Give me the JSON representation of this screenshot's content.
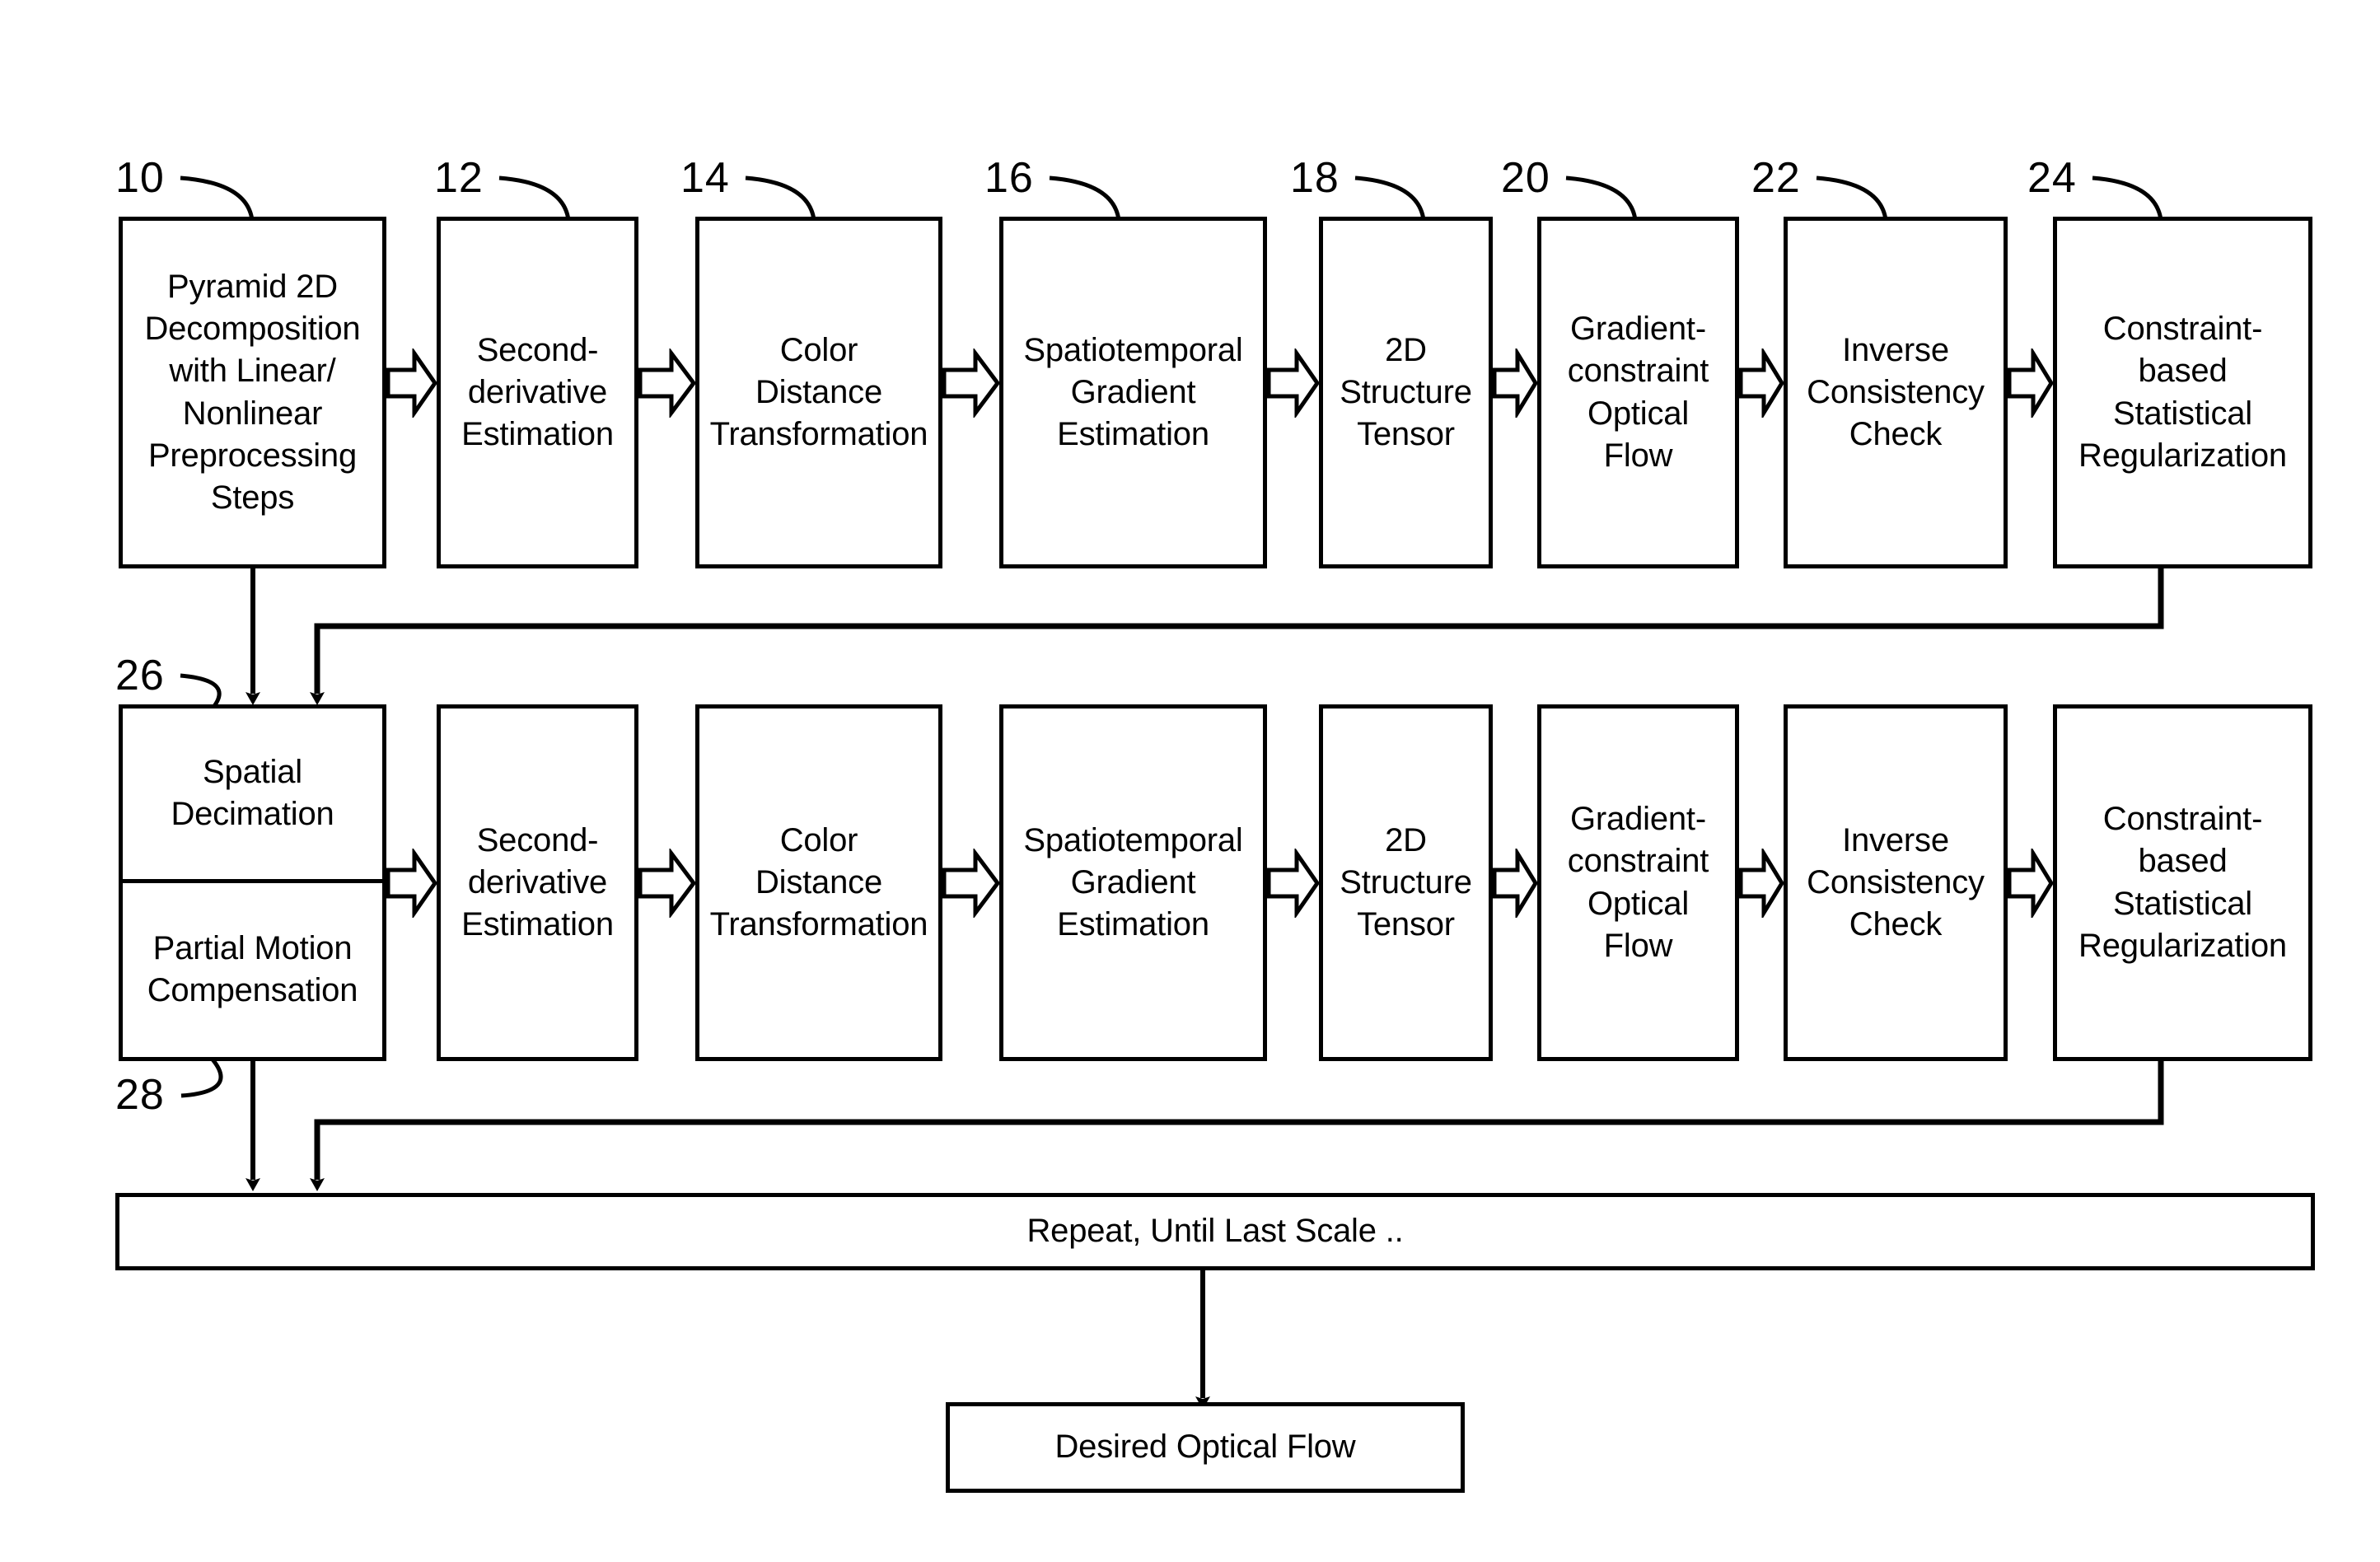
{
  "figure": {
    "type": "patent-flow-diagram",
    "background": "#ffffff",
    "stroke": "#000000"
  },
  "row1": {
    "nodes": [
      {
        "ref": "10",
        "label": "Pyramid 2D\nDecomposition\nwith Linear/\nNonlinear\nPreprocessing\nSteps"
      },
      {
        "ref": "12",
        "label": "Second-\nderivative\nEstimation"
      },
      {
        "ref": "14",
        "label": "Color\nDistance\nTransformation"
      },
      {
        "ref": "16",
        "label": "Spatiotemporal\nGradient\nEstimation"
      },
      {
        "ref": "18",
        "label": "2D\nStructure\nTensor"
      },
      {
        "ref": "20",
        "label": "Gradient-\nconstraint\nOptical\nFlow"
      },
      {
        "ref": "22",
        "label": "Inverse\nConsistency\nCheck"
      },
      {
        "ref": "24",
        "label": "Constraint-\nbased\nStatistical\nRegularization"
      }
    ]
  },
  "row2": {
    "nodes": [
      {
        "ref": "26",
        "ref2": "28",
        "label_top": "Spatial\nDecimation",
        "label_bottom": "Partial Motion\nCompensation"
      },
      {
        "label": "Second-\nderivative\nEstimation"
      },
      {
        "label": "Color\nDistance\nTransformation"
      },
      {
        "label": "Spatiotemporal\nGradient\nEstimation"
      },
      {
        "label": "2D\nStructure\nTensor"
      },
      {
        "label": "Gradient-\nconstraint\nOptical\nFlow"
      },
      {
        "label": "Inverse\nConsistency\nCheck"
      },
      {
        "label": "Constraint-\nbased\nStatistical\nRegularization"
      }
    ]
  },
  "repeat_bar": {
    "label": "Repeat, Until Last Scale .."
  },
  "terminal": {
    "label": "Desired Optical Flow"
  },
  "ref_labels": {
    "r10": "10",
    "r12": "12",
    "r14": "14",
    "r16": "16",
    "r18": "18",
    "r20": "20",
    "r22": "22",
    "r24": "24",
    "r26": "26",
    "r28": "28"
  }
}
